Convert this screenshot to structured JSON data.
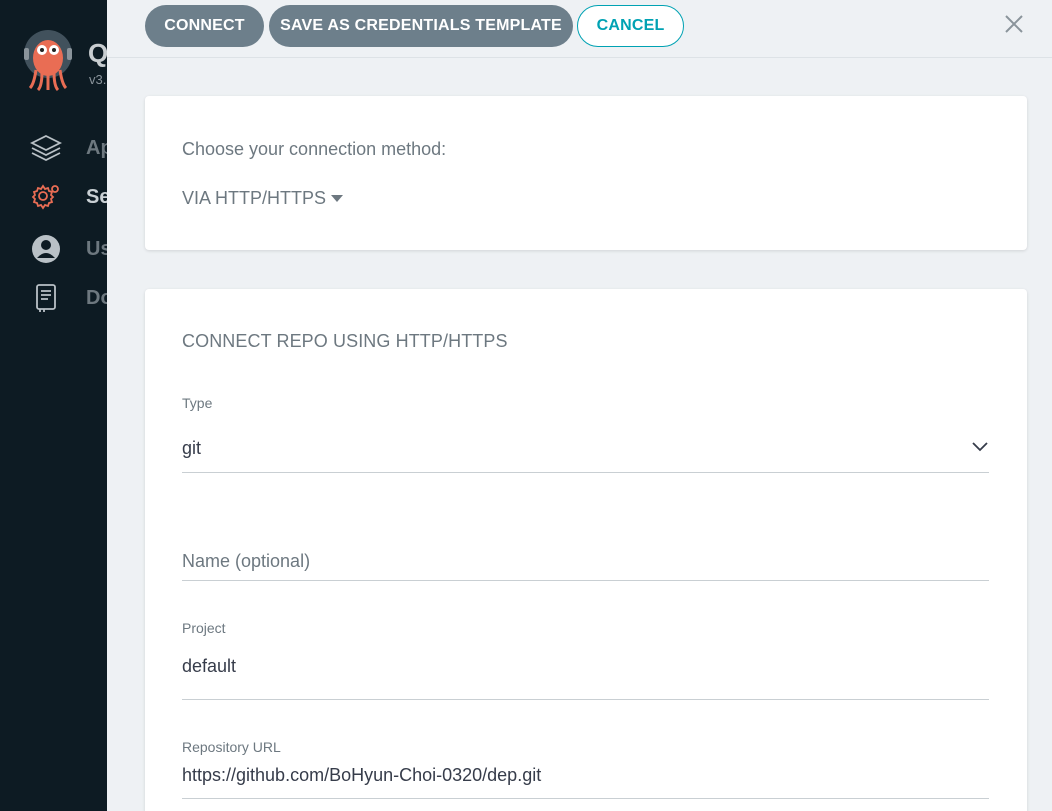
{
  "sidebar": {
    "brand_letter": "Q",
    "version": "v3.",
    "items": [
      {
        "label": "Ap",
        "icon": "layers-icon"
      },
      {
        "label": "Se",
        "icon": "gear-icon"
      },
      {
        "label": "Us",
        "icon": "user-icon"
      },
      {
        "label": "Do",
        "icon": "book-icon"
      }
    ]
  },
  "header": {
    "connect_label": "CONNECT",
    "save_template_label": "SAVE AS CREDENTIALS TEMPLATE",
    "cancel_label": "CANCEL"
  },
  "connection_method": {
    "label": "Choose your connection method:",
    "selected": "VIA HTTP/HTTPS"
  },
  "form": {
    "title": "CONNECT REPO USING HTTP/HTTPS",
    "type_label": "Type",
    "type_value": "git",
    "name_placeholder": "Name (optional)",
    "project_label": "Project",
    "project_value": "default",
    "repo_url_label": "Repository URL",
    "repo_url_value": "https://github.com/BoHyun-Choi-0320/dep.git"
  },
  "colors": {
    "accent": "#00a2b3",
    "active_nav_icon": "#e96d54",
    "primary_button": "#6d7f8b"
  }
}
